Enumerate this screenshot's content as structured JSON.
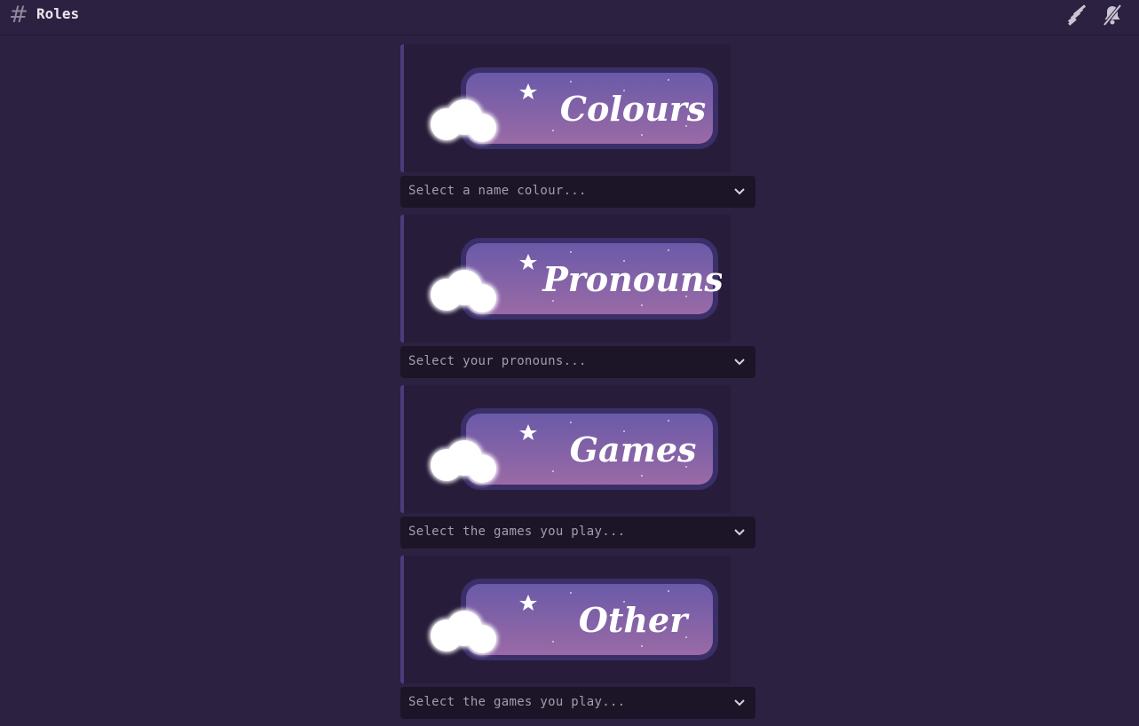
{
  "header": {
    "channel_hash": "#",
    "channel_name": "Roles",
    "icons": [
      "threads-icon",
      "mute-notifications-icon"
    ]
  },
  "sections": [
    {
      "banner_text": "Colours",
      "select_placeholder": "Select a name colour..."
    },
    {
      "banner_text": "Pronouns",
      "select_placeholder": "Select your pronouns..."
    },
    {
      "banner_text": "Games",
      "select_placeholder": "Select the games you play..."
    },
    {
      "banner_text": "Other",
      "select_placeholder": "Select the games you play..."
    }
  ],
  "colors": {
    "background": "#2d2142",
    "banner_gradient_top": "#6a5aa8",
    "banner_gradient_bottom": "#9a6aa6",
    "select_background": "#1c1528"
  }
}
